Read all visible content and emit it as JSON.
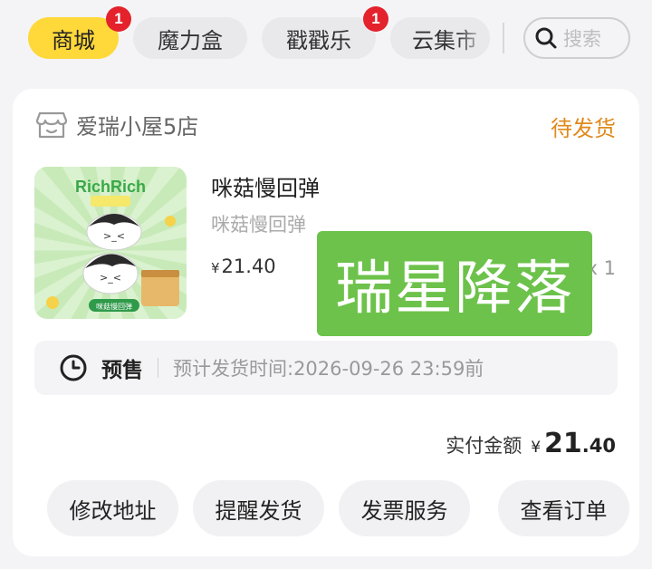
{
  "tabs": [
    {
      "label": "商城",
      "badge": "1",
      "active": true
    },
    {
      "label": "魔力盒"
    },
    {
      "label": "戳戳乐",
      "badge": "1"
    },
    {
      "label": "云集市"
    }
  ],
  "search": {
    "placeholder": "搜索"
  },
  "order": {
    "shop_name": "爱瑞小屋5店",
    "status": "待发货",
    "product": {
      "title": "咪菇慢回弹",
      "subtitle": "咪菇慢回弹",
      "price_symbol": "¥",
      "price": "21.40",
      "quantity": "x 1",
      "thumbnail_text": "RichRich",
      "thumbnail_badge": "咪菇慢回弹"
    },
    "watermark": "瑞星降落",
    "presale": {
      "label": "预售",
      "ship_time": "预计发货时间:2026-09-26 23:59前"
    },
    "payment": {
      "label": "实付金额",
      "symbol": "¥",
      "integer": "21",
      "decimal": ".40"
    },
    "actions": [
      "修改地址",
      "提醒发货",
      "发票服务",
      "查看订单"
    ]
  },
  "colors": {
    "active_tab": "#ffd83a",
    "badge": "#e3222c",
    "status": "#e08a1c",
    "watermark": "#6cc24a"
  }
}
